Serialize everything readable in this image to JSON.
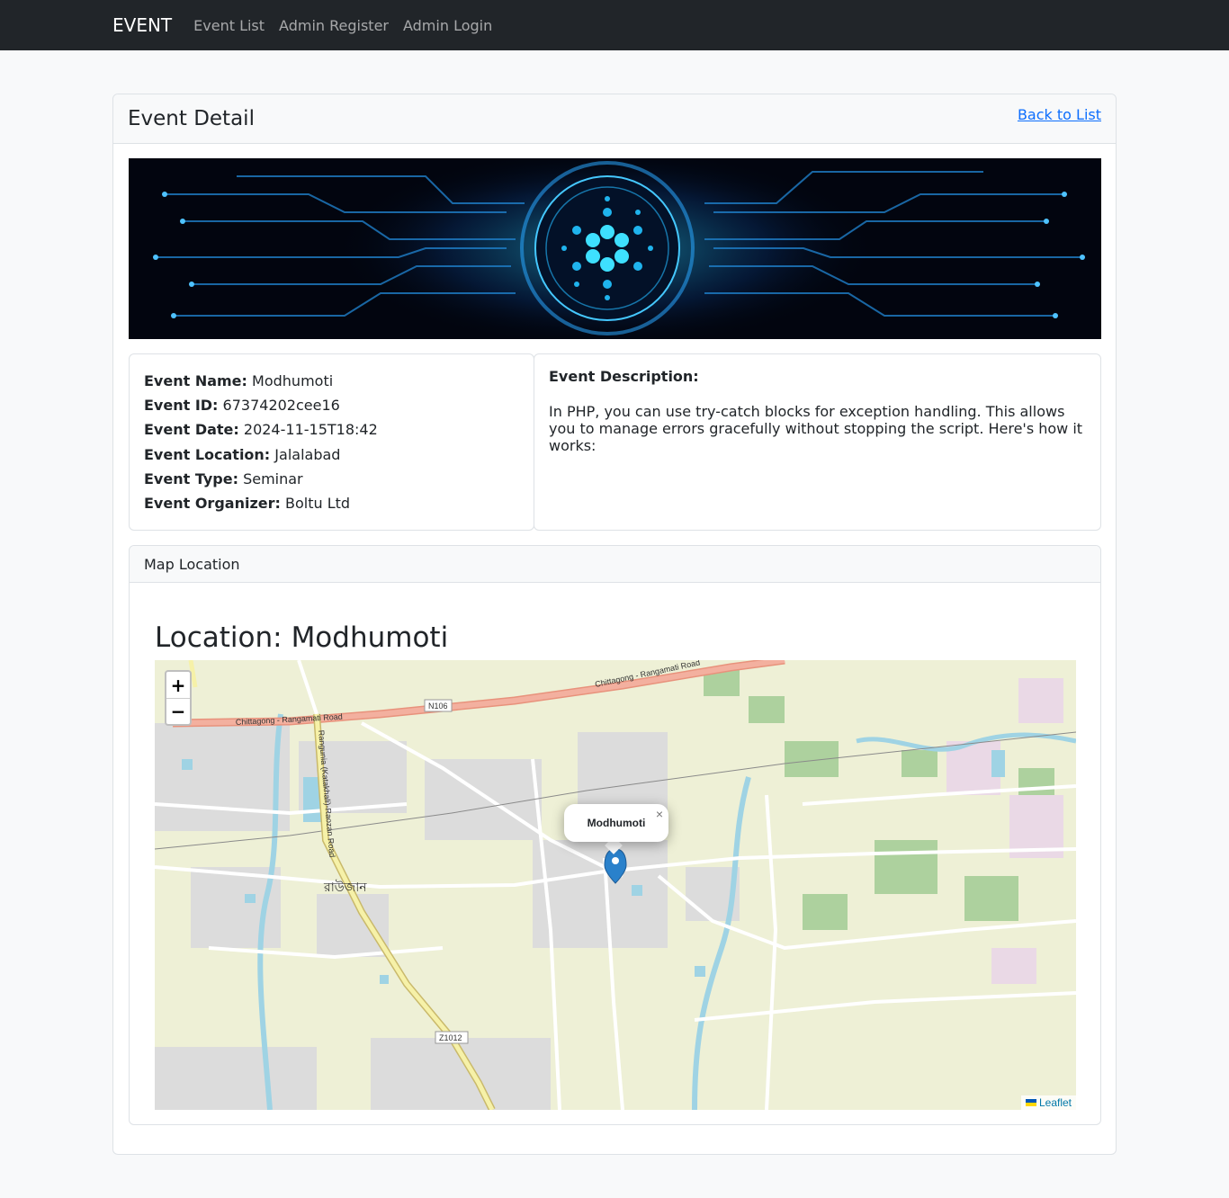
{
  "nav": {
    "brand": "EVENT",
    "links": [
      "Event List",
      "Admin Register",
      "Admin Login"
    ]
  },
  "page": {
    "title": "Event Detail",
    "back_link": "Back to List"
  },
  "event": {
    "name_label": "Event Name:",
    "name": "Modhumoti",
    "id_label": "Event ID:",
    "id": "67374202cee16",
    "date_label": "Event Date:",
    "date": "2024-11-15T18:42",
    "location_label": "Event Location:",
    "location": "Jalalabad",
    "type_label": "Event Type:",
    "type": "Seminar",
    "organizer_label": "Event Organizer:",
    "organizer": "Boltu Ltd",
    "description_label": "Event Description:",
    "description": "In PHP, you can use try-catch blocks for exception handling. This allows you to manage errors gracefully without stopping the script. Here's how it works:"
  },
  "map": {
    "header": "Map Location",
    "location_prefix": "Location:",
    "location_name": "Modhumoti",
    "zoom_in": "+",
    "zoom_out": "−",
    "popup_label": "Modhumoti",
    "popup_close": "×",
    "attribution": "Leaflet",
    "labels": {
      "highway_left": "Chittagong - Rangamati Road",
      "highway_right": "Chittagong - Rangamati Road",
      "route_n": "N106",
      "route_z": "Z1012",
      "road_vertical": "Rangunia (Katakhali)-Raozan Road",
      "town": "রাউজান"
    }
  }
}
